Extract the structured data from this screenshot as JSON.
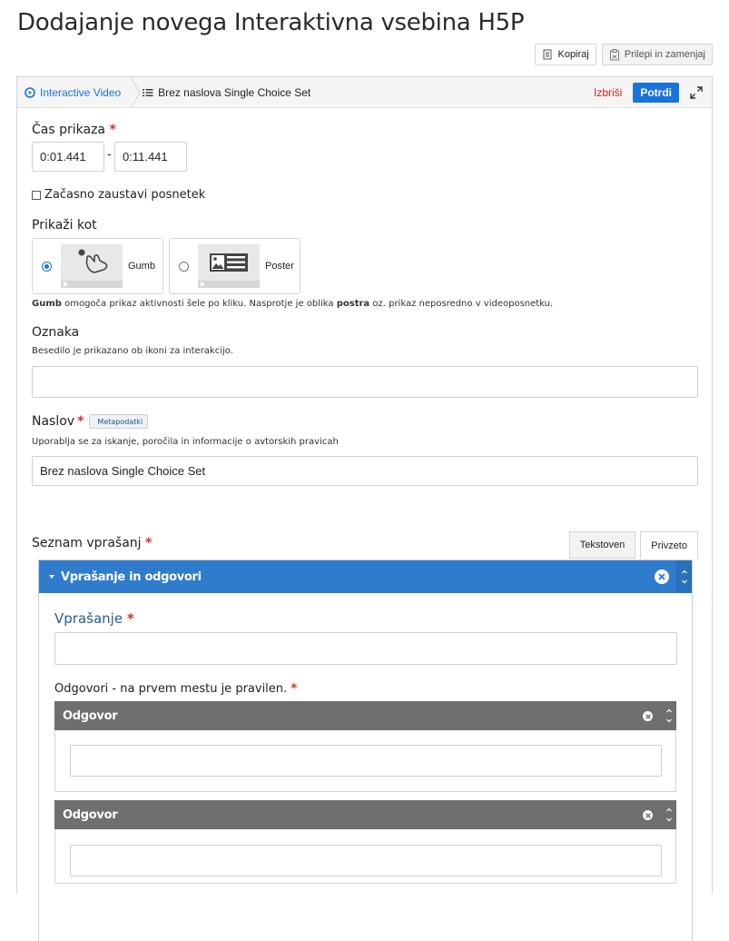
{
  "page": {
    "title": "Dodajanje novega Interaktivna vsebina H5P"
  },
  "copy_bar": {
    "copy_label": "Kopiraj",
    "paste_label": "Prilepi in zamenjaj"
  },
  "breadcrumb": {
    "root": "Interactive Video",
    "current": "Brez naslova Single Choice Set"
  },
  "actions": {
    "delete_label": "Izbriši",
    "confirm_label": "Potrdi"
  },
  "display_time": {
    "label": "Čas prikaza",
    "start": "0:01.441",
    "separator": "-",
    "end": "0:11.441"
  },
  "pause": {
    "label": "Začasno zaustavi posnetek",
    "checked": false
  },
  "display_as": {
    "label": "Prikaži kot",
    "options": [
      {
        "label": "Gumb",
        "selected": true
      },
      {
        "label": "Poster",
        "selected": false
      }
    ],
    "help_b1": "Gumb",
    "help_t1": " omogoča prikaz aktivnosti šele po kliku. Nasprotje je oblika ",
    "help_b2": "postra",
    "help_t2": " oz. prikaz neposredno v videoposnetku."
  },
  "oznaka": {
    "label": "Oznaka",
    "description": "Besedilo je prikazano ob ikoni za interakcijo.",
    "value": ""
  },
  "naslov": {
    "label": "Naslov",
    "metadata_label": "Metapodatki",
    "description": "Uporablja se za iskanje, poročila in informacije o avtorskih pravicah",
    "value": "Brez naslova Single Choice Set"
  },
  "question_list": {
    "label": "Seznam vprašanj",
    "tabs": [
      "Tekstoven",
      "Privzeto"
    ],
    "active_tab": "Privzeto",
    "group_title": "Vprašanje in odgovori",
    "question_label": "Vprašanje",
    "question_value": "",
    "answers_label": "Odgovori - na prvem mestu je pravilen.",
    "answers": [
      {
        "title": "Odgovor",
        "value": ""
      },
      {
        "title": "Odgovor",
        "value": ""
      }
    ]
  },
  "colors": {
    "accent": "#1a73d9",
    "group_header": "#2f7ccd",
    "sub_header": "#6f6f6f",
    "danger": "#d01e1e"
  }
}
